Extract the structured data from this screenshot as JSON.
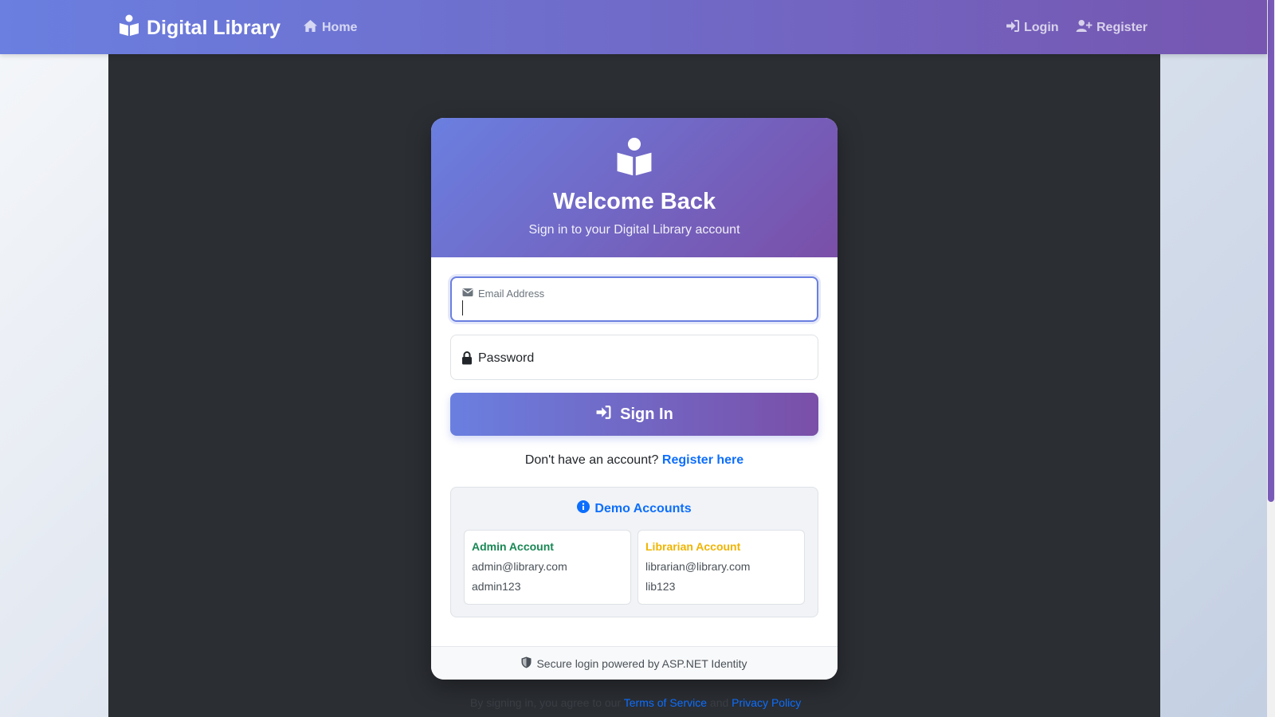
{
  "navbar": {
    "brand": "Digital Library",
    "home": "Home",
    "login": "Login",
    "register": "Register"
  },
  "card": {
    "title": "Welcome Back",
    "subtitle": "Sign in to your Digital Library account",
    "email_label": "Email Address",
    "email_value": "",
    "password_label": "Password",
    "password_value": "",
    "signin": "Sign In",
    "no_account": "Don't have an account?",
    "register_link": "Register here",
    "demo_title": "Demo Accounts",
    "demo_accounts": [
      {
        "title": "Admin Account",
        "email": "admin@library.com",
        "password": "admin123",
        "color": "#198754"
      },
      {
        "title": "Librarian Account",
        "email": "librarian@library.com",
        "password": "lib123",
        "color": "#f0b400"
      }
    ],
    "footer": "Secure login powered by ASP.NET Identity"
  },
  "terms": {
    "prefix": "By signing in, you agree to our",
    "terms_link": "Terms of Service",
    "joiner": "and",
    "privacy_link": "Privacy Policy"
  },
  "colors": {
    "gradient_start": "#6a7fe0",
    "gradient_end": "#7656b0",
    "link": "#0d6efd"
  },
  "icons": [
    "book-reader-icon",
    "home-icon",
    "sign-in-icon",
    "user-plus-icon",
    "envelope-icon",
    "lock-icon",
    "info-icon",
    "shield-icon"
  ]
}
